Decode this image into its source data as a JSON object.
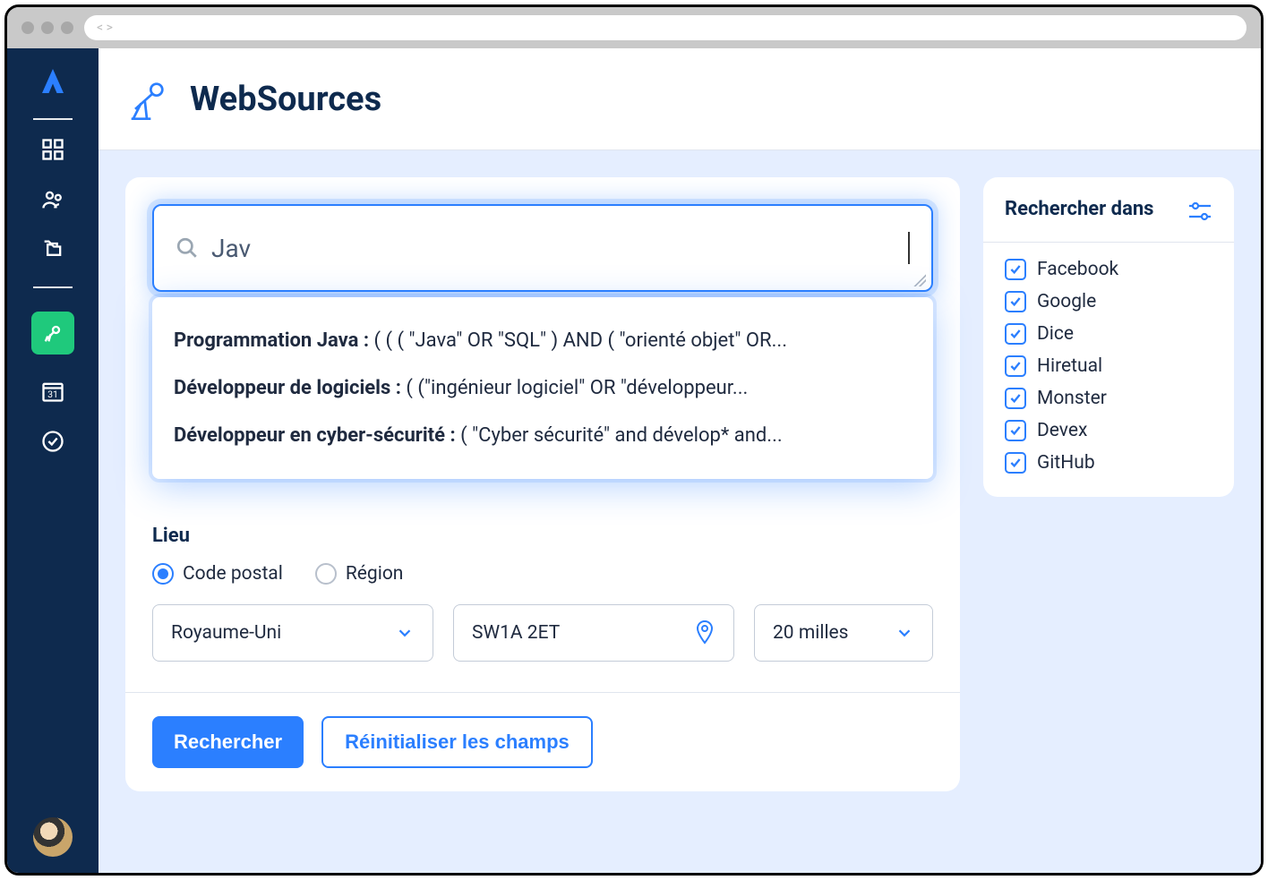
{
  "header": {
    "title": "WebSources"
  },
  "search": {
    "value": "Jav",
    "suggestions": [
      {
        "title": "Programmation Java :",
        "query": " ( ( ( \"Java\" OR \"SQL\" ) AND ( \"orienté objet\" OR..."
      },
      {
        "title": "Développeur de logiciels :",
        "query": " ( (\"ingénieur logiciel\" OR \"développeur..."
      },
      {
        "title": "Développeur en cyber-sécurité :",
        "query": " ( \"Cyber sécurité\" and dévelop* and..."
      }
    ]
  },
  "location": {
    "label": "Lieu",
    "radios": {
      "postal": "Code postal",
      "region": "Région"
    },
    "country": "Royaume-Uni",
    "postal_code": "SW1A 2ET",
    "radius": "20 milles"
  },
  "buttons": {
    "search": "Rechercher",
    "reset": "Réinitialiser les champs"
  },
  "filters": {
    "title": "Rechercher dans",
    "sources": [
      "Facebook",
      "Google",
      "Dice",
      "Hiretual",
      "Monster",
      "Devex",
      "GitHub"
    ]
  }
}
